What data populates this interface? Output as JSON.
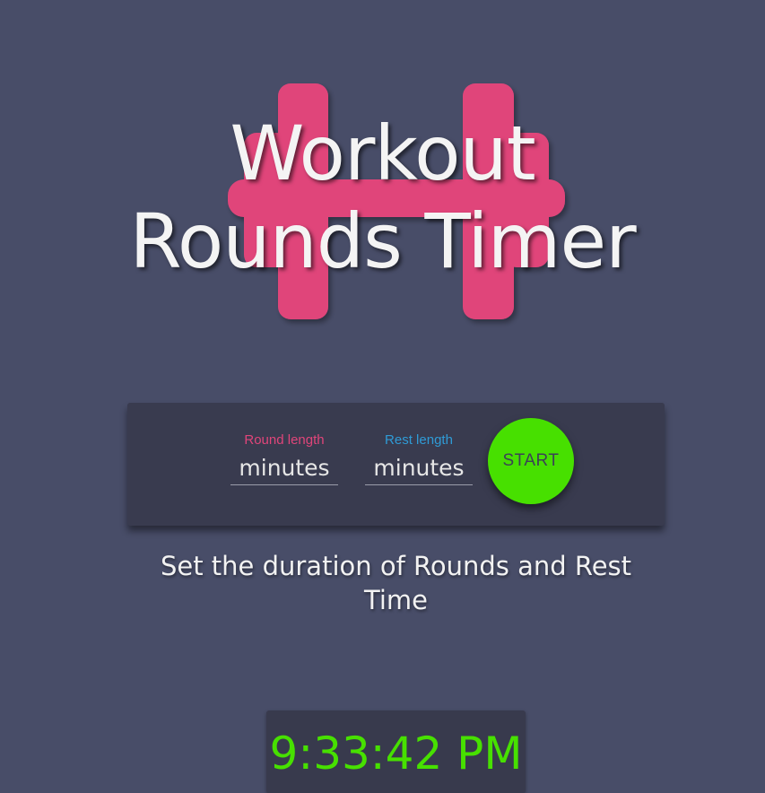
{
  "header": {
    "title_line1": "Workout",
    "title_line2": "Rounds Timer",
    "logo_icon": "dumbbell-icon"
  },
  "form": {
    "round_label": "Round length",
    "round_placeholder": "minutes",
    "rest_label": "Rest length",
    "rest_placeholder": "minutes",
    "start_label": "START"
  },
  "instructions": "Set the duration of Rounds and Rest Time",
  "clock": {
    "time": "9:33:42 PM"
  },
  "colors": {
    "background": "#484d68",
    "panel": "#393b4f",
    "logo": "#e0457a",
    "round_label": "#e0457a",
    "rest_label": "#2f9bd6",
    "start_button": "#47e000",
    "clock_text": "#47e000"
  }
}
